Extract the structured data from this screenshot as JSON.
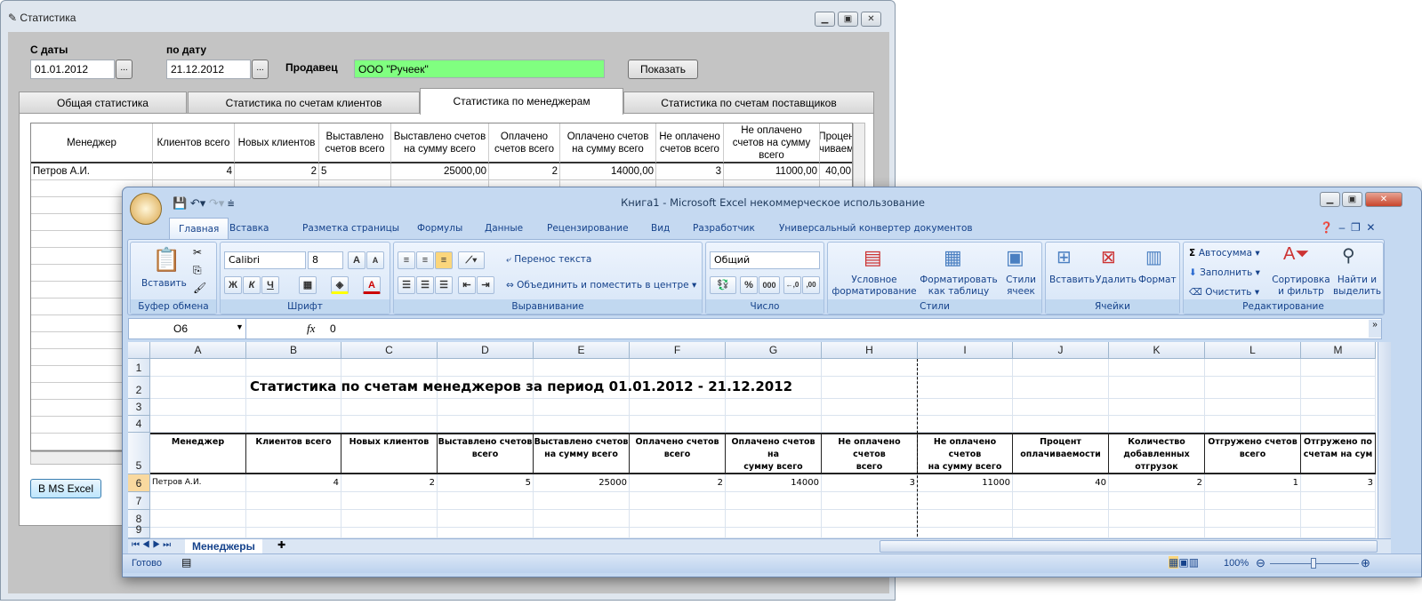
{
  "app": {
    "title": "Статистика",
    "from_label": "С даты",
    "from_value": "01.01.2012",
    "to_label": "по дату",
    "to_value": "21.12.2012",
    "seller_label": "Продавец",
    "seller_value": "ООО \"Ручеек\"",
    "seller_bg": "#80ff80",
    "dots": "...",
    "show_button": "Показать",
    "excel_button": "В MS Excel",
    "tabs": [
      "Общая статистика",
      "Статистика по счетам клиентов",
      "Статистика по менеджерам",
      "Статистика по счетам поставщиков"
    ],
    "active_tab": 2,
    "grid": {
      "headers": [
        "Менеджер",
        "Клиентов всего",
        "Новых клиентов",
        "Выставлено\nсчетов всего",
        "Выставлено счетов\nна сумму всего",
        "Оплачено\nсчетов всего",
        "Оплачено счетов\nна сумму всего",
        "Не оплачено\nсчетов всего",
        "Не оплачено\nсчетов на сумму\nвсего",
        "Процен\nчиваем"
      ],
      "rows": [
        [
          "Петров А.И.",
          "4",
          "2",
          "5",
          "25000,00",
          "2",
          "14000,00",
          "3",
          "11000,00",
          "40,00"
        ]
      ]
    }
  },
  "excel": {
    "title": "Книга1 - Microsoft Excel некоммерческое использование",
    "tabs": [
      "Главная",
      "Вставка",
      "Разметка страницы",
      "Формулы",
      "Данные",
      "Рецензирование",
      "Вид",
      "Разработчик",
      "Универсальный конвертер документов"
    ],
    "ribbon": {
      "paste": "Вставить",
      "clipboard": "Буфер обмена",
      "font_name": "Calibri",
      "font_size": "8",
      "font": "Шрифт",
      "bold": "Ж",
      "italic": "К",
      "underline": "Ч",
      "wrap": "Перенос текста",
      "merge": "Объединить и поместить в центре",
      "alignment": "Выравнивание",
      "number_format": "Общий",
      "number": "Число",
      "percent": "%",
      "thousands": "000",
      "cond_format": "Условное\nформатирование",
      "format_table": "Форматировать\nкак таблицу",
      "cell_styles": "Стили\nячеек",
      "styles": "Стили",
      "insert": "Вставить",
      "delete": "Удалить",
      "format": "Формат",
      "cells": "Ячейки",
      "autosum": "Автосумма",
      "fill": "Заполнить",
      "clear": "Очистить",
      "sort": "Сортировка\nи фильтр",
      "find": "Найти и\nвыделить",
      "editing": "Редактирование"
    },
    "name_box": "O6",
    "formula": "0",
    "fx": "fx",
    "columns": [
      "A",
      "B",
      "C",
      "D",
      "E",
      "F",
      "G",
      "H",
      "I",
      "J",
      "K",
      "L",
      "M"
    ],
    "rows": [
      "1",
      "2",
      "3",
      "4",
      "5",
      "6",
      "7",
      "8",
      "9"
    ],
    "sheet_title": "Статистика по счетам менеджеров за период  01.01.2012 - 21.12.2012",
    "headers": [
      "Менеджер",
      "Клиентов всего",
      "Новых клиентов",
      "Выставлено счетов\nвсего",
      "Выставлено счетов\nна сумму всего",
      "Оплачено счетов\nвсего",
      "Оплачено счетов на\nсумму всего",
      "Не оплачено счетов\nвсего",
      "Не оплачено счетов\nна сумму всего",
      "Процент\nоплачиваемости",
      "Количество\nдобавленных\nотгрузок",
      "Отгружено счетов\nвсего",
      "Отгружено по\nсчетам на сум"
    ],
    "data_row": [
      "Петров А.И.",
      "4",
      "2",
      "5",
      "25000",
      "2",
      "14000",
      "3",
      "11000",
      "40",
      "2",
      "1",
      "3"
    ],
    "sheet_tab": "Менеджеры",
    "status": "Готово",
    "zoom": "100%"
  }
}
